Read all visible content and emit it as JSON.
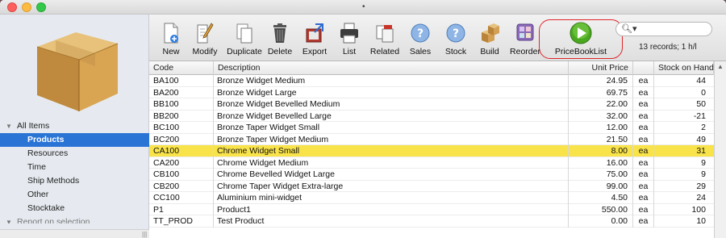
{
  "window": {
    "title": "•"
  },
  "sidebar": {
    "items": [
      {
        "label": "All Items",
        "type": "root",
        "expanded": true
      },
      {
        "label": "Products",
        "type": "child",
        "selected": true
      },
      {
        "label": "Resources",
        "type": "child"
      },
      {
        "label": "Time",
        "type": "child"
      },
      {
        "label": "Ship Methods",
        "type": "child"
      },
      {
        "label": "Other",
        "type": "child"
      },
      {
        "label": "Stocktake",
        "type": "child"
      },
      {
        "label": "Report on selection",
        "type": "root"
      }
    ]
  },
  "toolbar": {
    "buttons": [
      {
        "label": "New",
        "icon": "new-document-icon"
      },
      {
        "label": "Modify",
        "icon": "modify-pencil-icon"
      },
      {
        "label": "Duplicate",
        "icon": "duplicate-icon"
      },
      {
        "label": "Delete",
        "icon": "trash-icon"
      },
      {
        "label": "Export",
        "icon": "export-icon"
      },
      {
        "label": "List",
        "icon": "printer-icon"
      },
      {
        "label": "Related",
        "icon": "related-icon"
      },
      {
        "label": "Sales",
        "icon": "help-bubble-icon"
      },
      {
        "label": "Stock",
        "icon": "help-bubble-icon"
      },
      {
        "label": "Build",
        "icon": "build-boxes-icon"
      },
      {
        "label": "Reorder",
        "icon": "reorder-icon"
      },
      {
        "label": "PriceBookList",
        "icon": "play-green-icon"
      }
    ],
    "search_placeholder": "",
    "records_text": "13 records; 1 h/l",
    "highlight_color": "#e0242a"
  },
  "table": {
    "columns": [
      "Code",
      "Description",
      "Unit Price",
      "",
      "Stock on Hand"
    ],
    "rows": [
      {
        "code": "BA100",
        "description": "Bronze Widget Medium",
        "price": "24.95",
        "unit": "ea",
        "stock": "44"
      },
      {
        "code": "BA200",
        "description": "Bronze Widget Large",
        "price": "69.75",
        "unit": "ea",
        "stock": "0"
      },
      {
        "code": "BB100",
        "description": "Bronze Widget Bevelled Medium",
        "price": "22.00",
        "unit": "ea",
        "stock": "50"
      },
      {
        "code": "BB200",
        "description": "Bronze Widget Bevelled Large",
        "price": "32.00",
        "unit": "ea",
        "stock": "-21"
      },
      {
        "code": "BC100",
        "description": "Bronze Taper Widget Small",
        "price": "12.00",
        "unit": "ea",
        "stock": "2"
      },
      {
        "code": "BC200",
        "description": "Bronze Taper Widget Medium",
        "price": "21.50",
        "unit": "ea",
        "stock": "49"
      },
      {
        "code": "CA100",
        "description": "Chrome Widget Small",
        "price": "8.00",
        "unit": "ea",
        "stock": "31",
        "selected": true
      },
      {
        "code": "CA200",
        "description": "Chrome Widget Medium",
        "price": "16.00",
        "unit": "ea",
        "stock": "9"
      },
      {
        "code": "CB100",
        "description": "Chrome Bevelled Widget Large",
        "price": "75.00",
        "unit": "ea",
        "stock": "9"
      },
      {
        "code": "CB200",
        "description": "Chrome Taper Widget Extra-large",
        "price": "99.00",
        "unit": "ea",
        "stock": "29"
      },
      {
        "code": "CC100",
        "description": "Aluminium mini-widget",
        "price": "4.50",
        "unit": "ea",
        "stock": "24"
      },
      {
        "code": "P1",
        "description": "Product1",
        "price": "550.00",
        "unit": "ea",
        "stock": "100"
      },
      {
        "code": "TT_PROD",
        "description": "Test Product",
        "price": "0.00",
        "unit": "ea",
        "stock": "10"
      }
    ],
    "selected_row_color": "#f9e34a"
  }
}
